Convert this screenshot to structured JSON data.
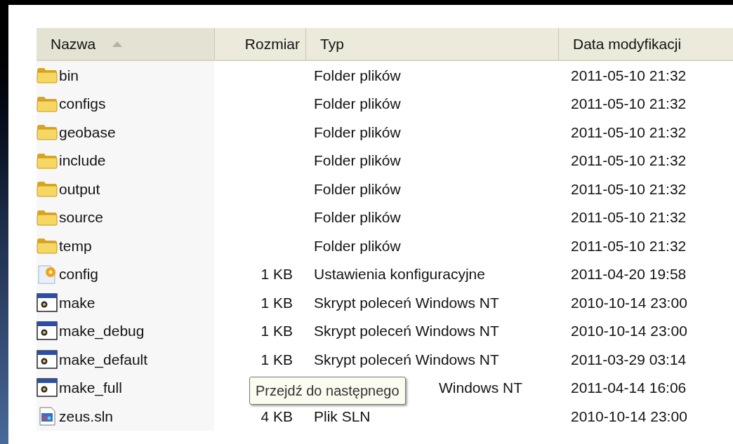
{
  "columns": [
    {
      "label": "Nazwa",
      "sorted": true
    },
    {
      "label": "Rozmiar",
      "sorted": false
    },
    {
      "label": "Typ",
      "sorted": false
    },
    {
      "label": "Data modyfikacji",
      "sorted": false
    }
  ],
  "rows": [
    {
      "kind": "folder",
      "name": "bin",
      "type": "Folder plików",
      "date": "2011-05-10 21:32"
    },
    {
      "kind": "folder",
      "name": "configs",
      "type": "Folder plików",
      "date": "2011-05-10 21:32"
    },
    {
      "kind": "folder",
      "name": "geobase",
      "type": "Folder plików",
      "date": "2011-05-10 21:32"
    },
    {
      "kind": "folder",
      "name": "include",
      "type": "Folder plików",
      "date": "2011-05-10 21:32"
    },
    {
      "kind": "folder",
      "name": "output",
      "type": "Folder plików",
      "date": "2011-05-10 21:32"
    },
    {
      "kind": "folder",
      "name": "source",
      "type": "Folder plików",
      "date": "2011-05-10 21:32"
    },
    {
      "kind": "folder",
      "name": "temp",
      "type": "Folder plików",
      "date": "2011-05-10 21:32"
    },
    {
      "kind": "config",
      "name": "config",
      "size": "1 KB",
      "type": "Ustawienia konfiguracyjne",
      "date": "2011-04-20 19:58"
    },
    {
      "kind": "script",
      "name": "make",
      "size": "1 KB",
      "type": "Skrypt poleceń Windows NT",
      "date": "2010-10-14 23:00"
    },
    {
      "kind": "script",
      "name": "make_debug",
      "size": "1 KB",
      "type": "Skrypt poleceń Windows NT",
      "date": "2010-10-14 23:00"
    },
    {
      "kind": "script",
      "name": "make_default",
      "size": "1 KB",
      "type": "Skrypt poleceń Windows NT",
      "date": "2011-03-29 03:14"
    },
    {
      "kind": "script",
      "name": "make_full",
      "type": "Windows NT",
      "date": "2011-04-14 16:06",
      "tooltip": "Przejdź do następnego"
    },
    {
      "kind": "solution",
      "name": "zeus.sln",
      "size": "4 KB",
      "type": "Plik SLN",
      "date": "2010-10-14 23:00"
    }
  ]
}
